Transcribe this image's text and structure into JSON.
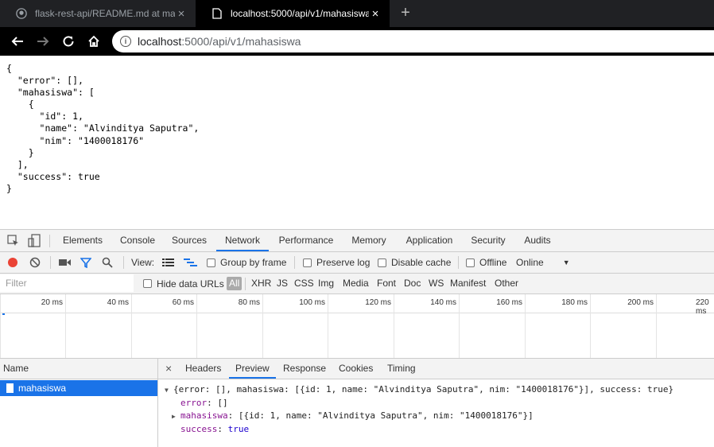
{
  "browser": {
    "tabs": [
      {
        "title": "flask-rest-api/README.md at ma",
        "active": false
      },
      {
        "title": "localhost:5000/api/v1/mahasiswa",
        "active": true
      }
    ],
    "new_tab_symbol": "+",
    "close_symbol": "×",
    "url_host": "localhost",
    "url_rest": ":5000/api/v1/mahasiswa"
  },
  "page": {
    "json_lines": [
      "{",
      "  \"error\": [],",
      "  \"mahasiswa\": [",
      "    {",
      "      \"id\": 1,",
      "      \"name\": \"Alvinditya Saputra\",",
      "      \"nim\": \"1400018176\"",
      "    }",
      "  ],",
      "  \"success\": true",
      "}"
    ]
  },
  "devtools": {
    "tabs": [
      "Elements",
      "Console",
      "Sources",
      "Network",
      "Performance",
      "Memory",
      "Application",
      "Security",
      "Audits"
    ],
    "selected_tab": "Network",
    "toolbar": {
      "view_label": "View:",
      "group_by_frame": "Group by frame",
      "preserve_log": "Preserve log",
      "disable_cache": "Disable cache",
      "offline": "Offline",
      "throttle": "Online"
    },
    "filter": {
      "placeholder": "Filter",
      "hide_data_urls": "Hide data URLs",
      "types": [
        "All",
        "XHR",
        "JS",
        "CSS",
        "Img",
        "Media",
        "Font",
        "Doc",
        "WS",
        "Manifest",
        "Other"
      ]
    },
    "timeline_ticks": [
      "20 ms",
      "40 ms",
      "60 ms",
      "80 ms",
      "100 ms",
      "120 ms",
      "140 ms",
      "160 ms",
      "180 ms",
      "200 ms",
      "220 ms"
    ],
    "requests": {
      "header": "Name",
      "rows": [
        "mahasiswa"
      ]
    },
    "detail": {
      "close_symbol": "×",
      "tabs": [
        "Headers",
        "Preview",
        "Response",
        "Cookies",
        "Timing"
      ],
      "selected_tab": "Preview",
      "preview": {
        "summary": "{error: [], mahasiswa: [{id: 1, name: \"Alvinditya Saputra\", nim: \"1400018176\"}], success: true}",
        "error_key": "error",
        "error_value": "[]",
        "mahasiswa_key": "mahasiswa",
        "mahasiswa_value": "[{id: 1, name: \"Alvinditya Saputra\", nim: \"1400018176\"}]",
        "success_key": "success",
        "success_value": "true"
      }
    }
  },
  "colors": {
    "accent": "#1a73e8",
    "record": "#ea4335",
    "key": "#881391",
    "keyword": "#1c00cf"
  }
}
